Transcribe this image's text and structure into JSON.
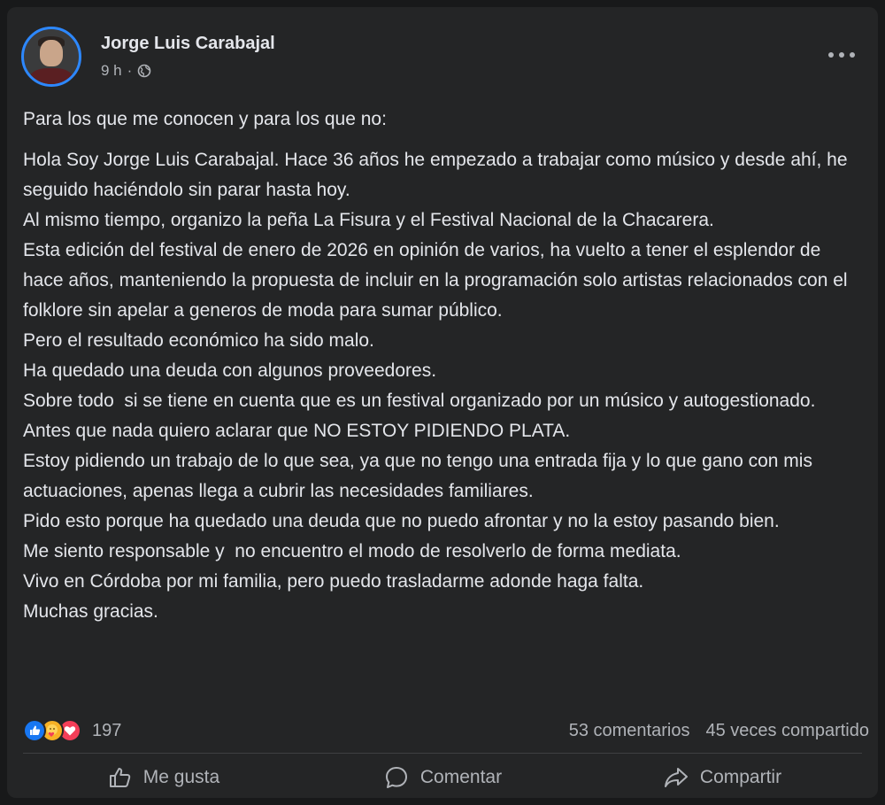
{
  "post": {
    "author": "Jorge Luis Carabajal",
    "time": "9 h",
    "separator": "·",
    "intro": "Para los que me conocen y para los que no:",
    "body": [
      "Hola Soy Jorge Luis Carabajal. Hace 36 años he empezado a trabajar como músico y desde ahí, he seguido haciéndolo sin parar hasta hoy.",
      "Al mismo tiempo, organizo la peña La Fisura y el Festival Nacional de la Chacarera.",
      "Esta edición del festival de enero de 2026 en opinión de varios, ha vuelto a tener el esplendor de hace años, manteniendo la propuesta de incluir en la programación solo artistas relacionados con el folklore sin apelar a generos de moda para sumar público.",
      "Pero el resultado económico ha sido malo.",
      "Ha quedado una deuda con algunos proveedores.",
      "Sobre todo  si se tiene en cuenta que es un festival organizado por un músico y autogestionado.",
      "Antes que nada quiero aclarar que NO ESTOY PIDIENDO PLATA.",
      "Estoy pidiendo un trabajo de lo que sea, ya que no tengo una entrada fija y lo que gano con mis actuaciones, apenas llega a cubrir las necesidades familiares.",
      "Pido esto porque ha quedado una deuda que no puedo afrontar y no la estoy pasando bien.",
      "Me siento responsable y  no encuentro el modo de resolverlo de forma mediata.",
      "Vivo en Córdoba por mi familia, pero puedo trasladarme adonde haga falta.",
      "Muchas gracias."
    ]
  },
  "stats": {
    "reaction_count": "197",
    "comments": "53 comentarios",
    "shares": "45 veces compartido",
    "reaction_icons": [
      "like-icon",
      "care-icon",
      "love-icon"
    ]
  },
  "actions": {
    "like": "Me gusta",
    "comment": "Comentar",
    "share": "Compartir"
  },
  "colors": {
    "background": "#18191a",
    "card": "#242526",
    "text": "#e4e6eb",
    "muted": "#b0b3b8",
    "avatar_ring": "#2d88ff"
  }
}
